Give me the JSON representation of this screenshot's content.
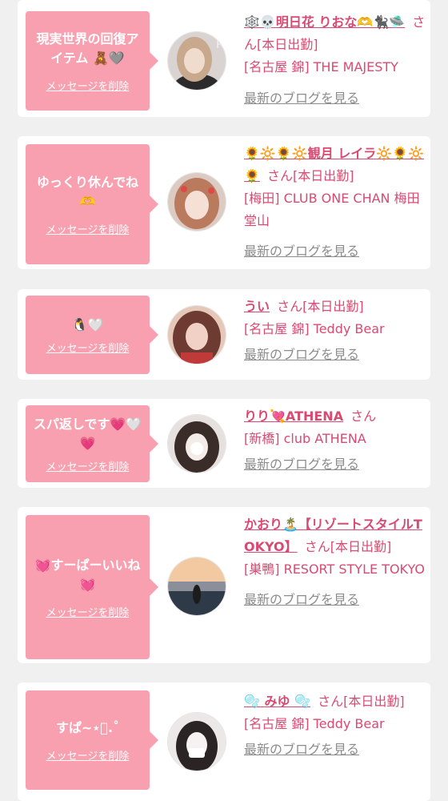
{
  "delete_label": "メッセージを削除",
  "blog_label": "最新のブログを見る",
  "san_label": "さん",
  "items": [
    {
      "message": "現実世界の回復アイテム 🧸🩶",
      "name": "🕸️💀明日花 りおな🫶🐈‍⬛🛸",
      "status": "[本日出勤]",
      "shop": "[名古屋 錦] THE MAJESTY",
      "avatar_colors": [
        "#d9c7b5",
        "#6b5446",
        "#f0e2d5"
      ]
    },
    {
      "message": "ゆっくり休んでね🫶",
      "name": "🌻🔆🌻🔆観月 レイラ🔆🌻🔆🌻",
      "status": "[本日出勤]",
      "shop": "[梅田] CLUB ONE CHAN 梅田堂山",
      "avatar_colors": [
        "#e8b9a6",
        "#b0684f",
        "#f6dfd5"
      ]
    },
    {
      "message": "🐧🤍",
      "name": "うい",
      "status": "[本日出勤]",
      "shop": "[名古屋 錦] Teddy Bear",
      "avatar_colors": [
        "#c89080",
        "#6e3b32",
        "#e8c3b8"
      ]
    },
    {
      "message": "スパ返しです💗🤍💗",
      "name": "りり💘ATHENA",
      "status": "",
      "shop": "[新橋] club ATHENA",
      "avatar_colors": [
        "#e6e1de",
        "#4a3a36",
        "#ffffff"
      ]
    },
    {
      "message": "💓すーぱーいいね💓",
      "name": "かおり🏝️【リゾートスタイルTOKYO】",
      "status": "[本日出勤]",
      "shop": "[巣鴨] RESORT STYLE TOKYO",
      "avatar_colors": [
        "#f3c9a2",
        "#54606e",
        "#2e3a47"
      ]
    },
    {
      "message": "すぱ~⋆͛.˚",
      "name": "🫧 みゆ 🫧",
      "status": "[本日出勤]",
      "shop": "[名古屋 錦] Teddy Bear",
      "avatar_colors": [
        "#e0dcdc",
        "#2a2424",
        "#f6f2f2"
      ]
    }
  ]
}
